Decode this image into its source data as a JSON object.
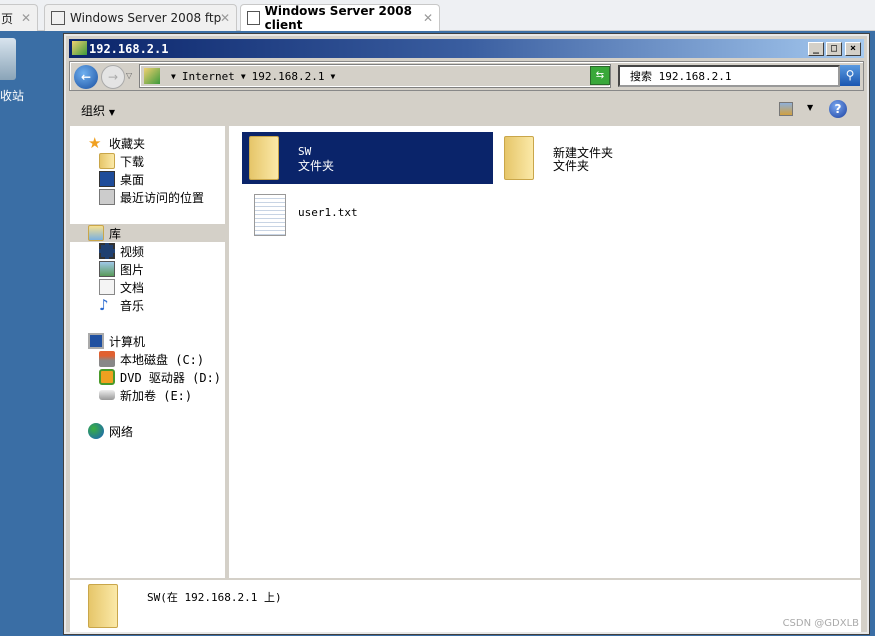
{
  "browser_tabs": [
    {
      "label": "页",
      "active": false
    },
    {
      "label": "Windows Server 2008 ftp",
      "active": false
    },
    {
      "label": "Windows Server 2008 client",
      "active": true
    }
  ],
  "desktop": {
    "recycle_label": "收站"
  },
  "window": {
    "title": "192.168.2.1",
    "min": "_",
    "max": "□",
    "close": "×"
  },
  "address": {
    "crumbs": [
      "Internet",
      "192.168.2.1"
    ],
    "search_placeholder": "搜索 192.168.2.1"
  },
  "toolbar": {
    "organize": "组织"
  },
  "nav": {
    "favorites": {
      "label": "收藏夹",
      "items": [
        "下载",
        "桌面",
        "最近访问的位置"
      ]
    },
    "libraries": {
      "label": "库",
      "items": [
        "视频",
        "图片",
        "文档",
        "音乐"
      ]
    },
    "computer": {
      "label": "计算机",
      "items": [
        "本地磁盘 (C:)",
        "DVD 驱动器 (D:) VM",
        "新加卷 (E:)"
      ]
    },
    "network": {
      "label": "网络"
    }
  },
  "files": [
    {
      "name": "SW",
      "type": "文件夹",
      "selected": true
    },
    {
      "name": "新建文件夹",
      "type": "文件夹",
      "selected": false
    },
    {
      "name": "user1.txt",
      "type": "",
      "selected": false
    }
  ],
  "details": {
    "text": "SW(在 192.168.2.1 上)"
  },
  "watermark": "CSDN @GDXLB",
  "colors": {
    "selection": "#0a246a",
    "desktop": "#3a6ea5"
  }
}
